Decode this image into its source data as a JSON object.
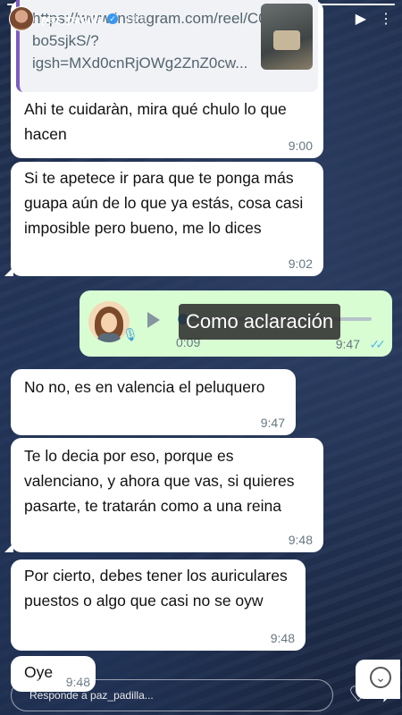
{
  "story": {
    "username": "paz_padilla",
    "time_ago": "13 h",
    "progress": 1.0
  },
  "messages": [
    {
      "id": "link",
      "link_text": "https://www.instagram.com/reel/C0Z-bo5sjkS/?igsh=MXd0cnRjOWg2ZnZ0cw...",
      "text": "Ahi te cuidaràn, mira qué chulo lo que hacen",
      "time": "9:00"
    },
    {
      "id": "m2",
      "text": "Si te apetece ir para que te ponga más guapa aún de lo que ya estás, cosa casi imposible pero bueno, me lo dices",
      "time": "9:02"
    },
    {
      "id": "voice",
      "duration": "0:09",
      "time": "9:47",
      "caption": "Como aclaración"
    },
    {
      "id": "m3",
      "text": "No no, es en valencia el peluquero",
      "time": "9:47"
    },
    {
      "id": "m4",
      "text": "Te lo decia por eso, porque es valenciano, y ahora que vas, si quieres pasarte, te tratarán como a una reina",
      "time": "9:48"
    },
    {
      "id": "m5",
      "text": "Por cierto, debes tener los auriculares puestos o algo que casi no se oyw",
      "time": "9:48"
    },
    {
      "id": "m6",
      "text": "Oye",
      "time": "9:48"
    }
  ],
  "reply": {
    "placeholder": "Responde a paz_padilla..."
  },
  "colors": {
    "incoming": "#ffffff",
    "outgoing": "#d9fdd3",
    "read_ticks": "#53bdeb",
    "link_bar": "#7c5cbf"
  }
}
